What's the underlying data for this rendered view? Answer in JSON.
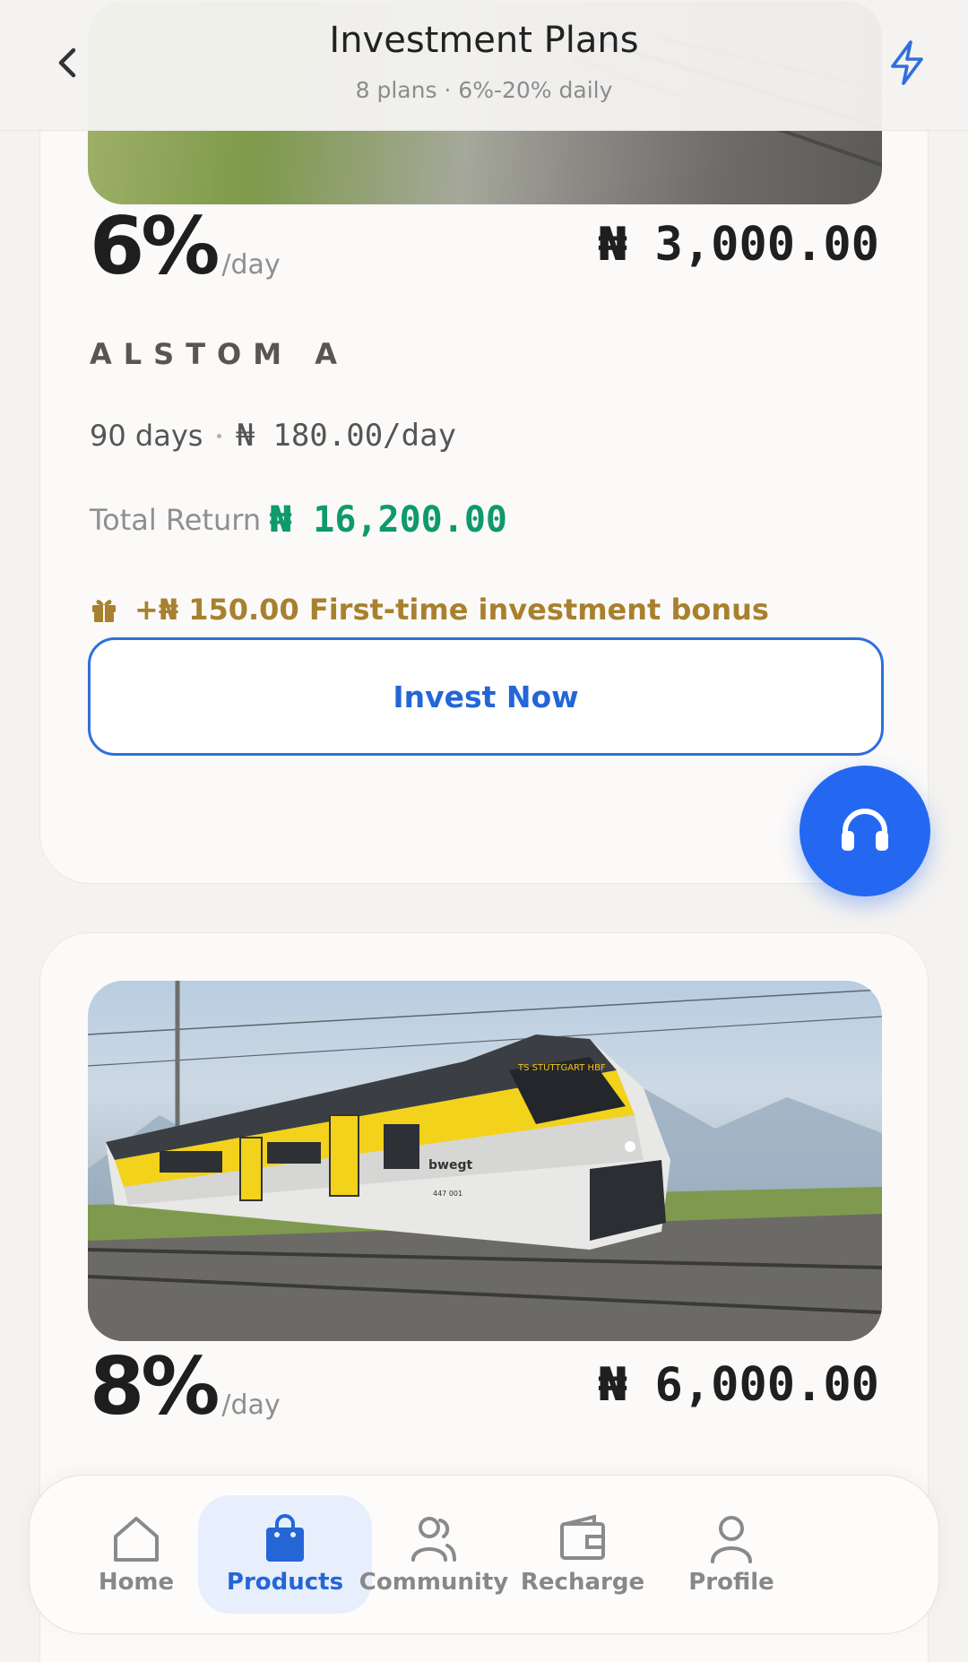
{
  "header": {
    "title": "Investment Plans",
    "subtitle": "8 plans · 6%-20% daily"
  },
  "plans": [
    {
      "rate": "6%",
      "per_day": "/day",
      "price": "₦ 3,000.00",
      "name": "ALSTOM A",
      "days": "90 days",
      "daily": "₦ 180.00/day",
      "total_label": "Total Return",
      "total_value": "₦ 16,200.00",
      "bonus": "+₦ 150.00 First-time investment bonus",
      "button": "Invest Now"
    },
    {
      "rate": "8%",
      "per_day": "/day",
      "price": "₦ 6,000.00"
    }
  ],
  "train": {
    "destination": "TS STUTTGART HBF",
    "brand": "bwegt",
    "number": "447 001"
  },
  "tabs": [
    {
      "label": "Home",
      "icon": "home-icon"
    },
    {
      "label": "Products",
      "icon": "shopping-bag-icon",
      "active": true
    },
    {
      "label": "Community",
      "icon": "community-icon"
    },
    {
      "label": "Recharge",
      "icon": "wallet-icon"
    },
    {
      "label": "Profile",
      "icon": "profile-icon"
    }
  ],
  "colors": {
    "accent": "#2466d6",
    "fab": "#2468f2",
    "total_return": "#0e9a6a",
    "bonus": "#a8802e",
    "background": "#f5f3f0"
  }
}
